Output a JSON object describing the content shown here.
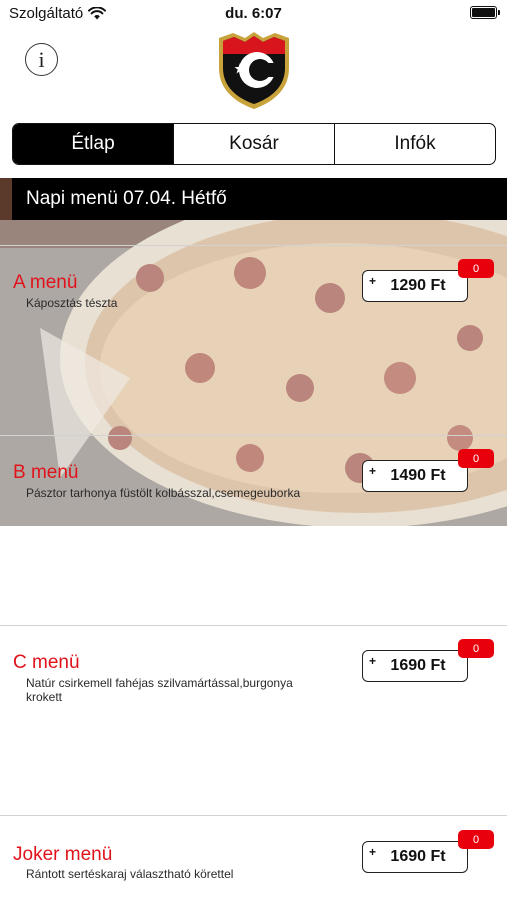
{
  "status_bar": {
    "carrier": "Szolgáltató",
    "time": "du. 6:07"
  },
  "tabs": [
    {
      "label": "Étlap",
      "active": true
    },
    {
      "label": "Kosár",
      "active": false
    },
    {
      "label": "Infók",
      "active": false
    }
  ],
  "day_header": "Napi menü 07.04. Hétfő",
  "menu": [
    {
      "name": "A menü",
      "description": "Káposztás tészta",
      "price": "1290 Ft",
      "quantity": "0"
    },
    {
      "name": "B menü",
      "description": "Pásztor tarhonya füstölt kolbásszal,csemegeuborka",
      "price": "1490 Ft",
      "quantity": "0"
    },
    {
      "name": "C menü",
      "description": "Natúr csirkemell fahéjas szilvamártással,burgonya krokett",
      "price": "1690 Ft",
      "quantity": "0"
    },
    {
      "name": "Joker menü",
      "description": "Rántott sertéskaraj választható körettel",
      "price": "1690 Ft",
      "quantity": "0"
    }
  ],
  "icons": {
    "info": "info-icon",
    "logo": "shield-logo",
    "add": "plus-icon",
    "wifi": "wifi-icon",
    "battery": "battery-icon"
  },
  "colors": {
    "accent_red": "#e0131b",
    "badge_red": "#e8000d",
    "active_tab": "#000000"
  }
}
